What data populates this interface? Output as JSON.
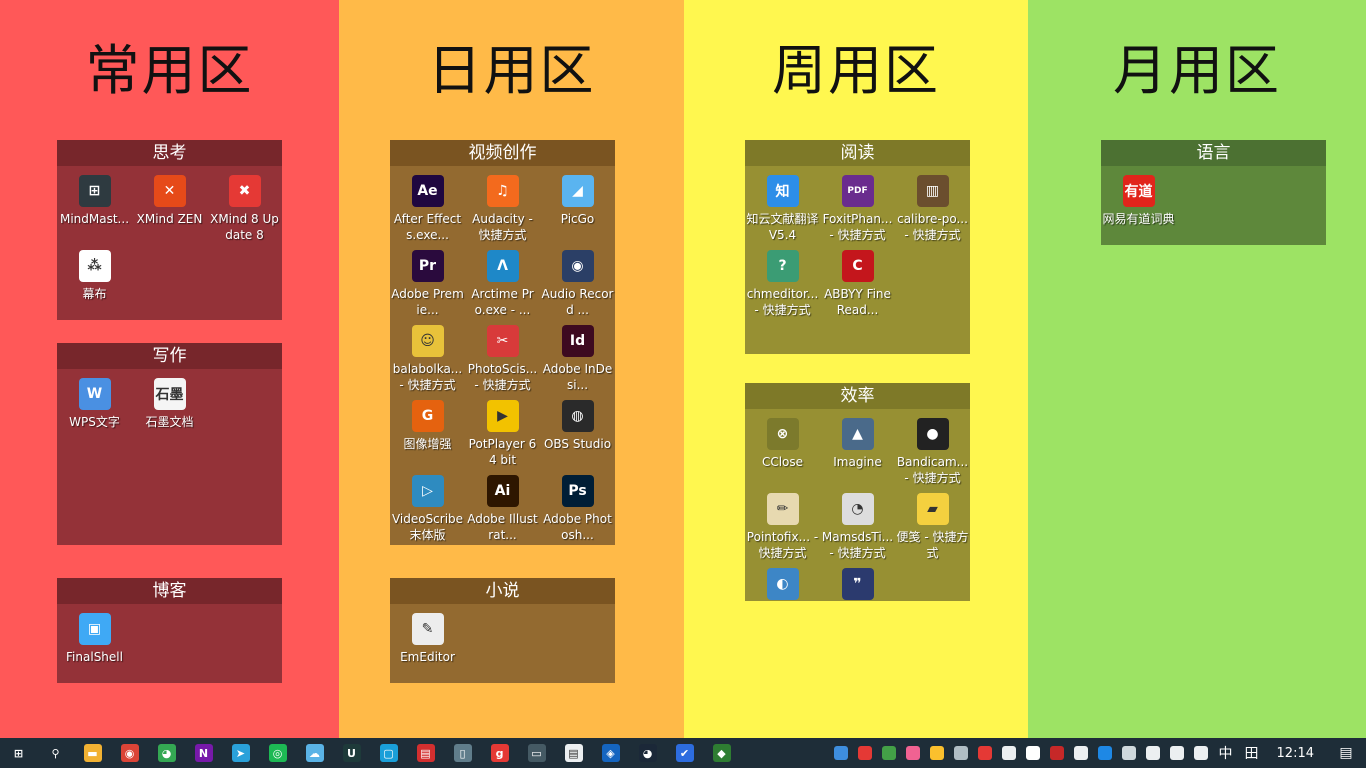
{
  "zones": [
    {
      "title": "常用区"
    },
    {
      "title": "日用区"
    },
    {
      "title": "周用区"
    },
    {
      "title": "月用区"
    }
  ],
  "fences": {
    "sikao": {
      "title": "思考",
      "icons": [
        {
          "label": "MindMast...",
          "icon": "mindmaster-icon",
          "glyph": "⊞",
          "color": "#2E3A40"
        },
        {
          "label": "XMind ZEN",
          "icon": "xmind-zen-icon",
          "glyph": "✕",
          "color": "#E64A19"
        },
        {
          "label": "XMind 8 Update 8",
          "icon": "xmind-8-icon",
          "glyph": "✖",
          "color": "#E53935"
        },
        {
          "label": "幕布",
          "icon": "mubu-icon",
          "glyph": "⁂",
          "color": "#FFFFFF"
        }
      ]
    },
    "xiezuo": {
      "title": "写作",
      "icons": [
        {
          "label": "WPS文字",
          "icon": "wps-writer-icon",
          "glyph": "W",
          "color": "#4A90E2"
        },
        {
          "label": "石墨文档",
          "icon": "shimo-docs-icon",
          "glyph": "石墨",
          "color": "#F5F5F5"
        }
      ]
    },
    "boke": {
      "title": "博客",
      "icons": [
        {
          "label": "FinalShell",
          "icon": "finalshell-icon",
          "glyph": "▣",
          "color": "#3FA9F5"
        }
      ]
    },
    "shipin": {
      "title": "视频创作",
      "icons": [
        {
          "label": "After Effects.exe...",
          "icon": "after-effects-icon",
          "glyph": "Ae",
          "color": "#1F0740"
        },
        {
          "label": "Audacity - 快捷方式",
          "icon": "audacity-icon",
          "glyph": "♫",
          "color": "#F36A1D"
        },
        {
          "label": "PicGo",
          "icon": "picgo-icon",
          "glyph": "◢",
          "color": "#5AB4F0"
        },
        {
          "label": "Adobe Premie...",
          "icon": "premiere-icon",
          "glyph": "Pr",
          "color": "#2A0A3D"
        },
        {
          "label": "Arctime Pro.exe - ...",
          "icon": "arctime-icon",
          "glyph": "Λ",
          "color": "#1E88C8"
        },
        {
          "label": "Audio Record ...",
          "icon": "audio-record-icon",
          "glyph": "◉",
          "color": "#2B3F66"
        },
        {
          "label": "balabolka... - 快捷方式",
          "icon": "balabolka-icon",
          "glyph": "☺",
          "color": "#E8C23A"
        },
        {
          "label": "PhotoScis... - 快捷方式",
          "icon": "photoscissors-icon",
          "glyph": "✂",
          "color": "#D83A3A"
        },
        {
          "label": "Adobe InDesi...",
          "icon": "indesign-icon",
          "glyph": "Id",
          "color": "#3D0A20"
        },
        {
          "label": "图像增强",
          "icon": "image-enhance-icon",
          "glyph": "G",
          "color": "#E5620F"
        },
        {
          "label": "PotPlayer 64 bit",
          "icon": "potplayer-icon",
          "glyph": "▶",
          "color": "#F2C200"
        },
        {
          "label": "OBS Studio",
          "icon": "obs-icon",
          "glyph": "◍",
          "color": "#2A2A2A"
        },
        {
          "label": "VideoScribe 末体版",
          "icon": "videoscribe-icon",
          "glyph": "▷",
          "color": "#2E8BC0"
        },
        {
          "label": "Adobe Illustrat...",
          "icon": "illustrator-icon",
          "glyph": "Ai",
          "color": "#2E1600"
        },
        {
          "label": "Adobe Photosh...",
          "icon": "photoshop-icon",
          "glyph": "Ps",
          "color": "#001E36"
        }
      ]
    },
    "xiaoshuo": {
      "title": "小说",
      "icons": [
        {
          "label": "EmEditor",
          "icon": "emeditor-icon",
          "glyph": "✎",
          "color": "#EDEDED"
        }
      ]
    },
    "yuedu": {
      "title": "阅读",
      "icons": [
        {
          "label": "知云文献翻译V5.4",
          "icon": "zhiyun-icon",
          "glyph": "知",
          "color": "#2C8EE8"
        },
        {
          "label": "FoxitPhan... - 快捷方式",
          "icon": "foxit-phantom-icon",
          "glyph": "PDF",
          "color": "#6A2C8E"
        },
        {
          "label": "calibre-po... - 快捷方式",
          "icon": "calibre-icon",
          "glyph": "▥",
          "color": "#6B4E2E"
        },
        {
          "label": "chmeditor... - 快捷方式",
          "icon": "chmeditor-icon",
          "glyph": "?",
          "color": "#3B9C74"
        },
        {
          "label": "ABBYY FineRead...",
          "icon": "abbyy-icon",
          "glyph": "C",
          "color": "#C4161C"
        }
      ]
    },
    "xiaolv": {
      "title": "效率",
      "icons": [
        {
          "label": "CClose",
          "icon": "cclose-icon",
          "glyph": "⊗",
          "color": "#7C7A2C"
        },
        {
          "label": "Imagine",
          "icon": "imagine-icon",
          "glyph": "▲",
          "color": "#4A6A8A"
        },
        {
          "label": "Bandicam... - 快捷方式",
          "icon": "bandicam-icon",
          "glyph": "●",
          "color": "#222222"
        },
        {
          "label": "Pointofix... - 快捷方式",
          "icon": "pointofix-icon",
          "glyph": "✏",
          "color": "#E7D9B0"
        },
        {
          "label": "MamsdsTi... - 快捷方式",
          "icon": "mamsds-timer-icon",
          "glyph": "◔",
          "color": "#DDDDDD"
        },
        {
          "label": "便笺 - 快捷方式",
          "icon": "sticky-notes-icon",
          "glyph": "▰",
          "color": "#F4D03F"
        },
        {
          "label": "",
          "icon": "globe-app-icon",
          "glyph": "◐",
          "color": "#3D86C6"
        },
        {
          "label": "",
          "icon": "quote-app-icon",
          "glyph": "❞",
          "color": "#2B3A6E"
        }
      ]
    },
    "yuyan": {
      "title": "语言",
      "icons": [
        {
          "label": "网易有道词典",
          "icon": "youdao-dict-icon",
          "glyph": "有道",
          "color": "#E1251B"
        }
      ]
    }
  },
  "taskbar": {
    "pinned": [
      {
        "icon": "windows-start-icon",
        "glyph": "⊞",
        "color": "#1E2D38"
      },
      {
        "icon": "search-icon",
        "glyph": "⚲",
        "color": "#1E2D38"
      },
      {
        "icon": "file-explorer-icon",
        "glyph": "▬",
        "color": "#F2B233"
      },
      {
        "icon": "chrome-icon",
        "glyph": "◉",
        "color": "#DB4437"
      },
      {
        "icon": "color-app-icon",
        "glyph": "◕",
        "color": "#34A853"
      },
      {
        "icon": "onenote-icon",
        "glyph": "N",
        "color": "#7719AA"
      },
      {
        "icon": "telegram-icon",
        "glyph": "➤",
        "color": "#2AA1DA"
      },
      {
        "icon": "green-app-icon",
        "glyph": "◎",
        "color": "#1DB954"
      },
      {
        "icon": "cloud-icon",
        "glyph": "☁",
        "color": "#5AB3E6"
      },
      {
        "icon": "upwork-icon",
        "glyph": "U",
        "color": "#1E3A3A"
      },
      {
        "icon": "window-app-icon",
        "glyph": "▢",
        "color": "#1A9FD9"
      },
      {
        "icon": "photo-app-icon",
        "glyph": "▤",
        "color": "#D32F2F"
      },
      {
        "icon": "phone-app-icon",
        "glyph": "▯",
        "color": "#607D8B"
      },
      {
        "icon": "red-app-icon",
        "glyph": "g",
        "color": "#E53935"
      },
      {
        "icon": "monitor-app-icon",
        "glyph": "▭",
        "color": "#455A64"
      },
      {
        "icon": "notes-app-icon",
        "glyph": "▤",
        "color": "#ECEFF1"
      },
      {
        "icon": "shield-app-icon",
        "glyph": "◈",
        "color": "#1565C0"
      },
      {
        "icon": "steam-icon",
        "glyph": "◕",
        "color": "#1B2838"
      },
      {
        "icon": "todo-icon",
        "glyph": "✔",
        "color": "#2D6CDF"
      },
      {
        "icon": "active-app-icon",
        "glyph": "◆",
        "color": "#2E7D32"
      }
    ],
    "tray": [
      {
        "icon": "tray-blue-icon",
        "color": "#3E8EDE"
      },
      {
        "icon": "tray-red-icon",
        "color": "#E53935"
      },
      {
        "icon": "tray-green-icon",
        "color": "#43A047"
      },
      {
        "icon": "tray-pig-icon",
        "color": "#F06292"
      },
      {
        "icon": "tray-chrome-icon",
        "color": "#FBC02D"
      },
      {
        "icon": "tray-cloud-icon",
        "color": "#B0BEC5"
      },
      {
        "icon": "tray-screen-icon",
        "color": "#E53935"
      },
      {
        "icon": "tray-gear-icon",
        "color": "#ECEFF1"
      },
      {
        "icon": "tray-obs-icon",
        "color": "#FFFFFF"
      },
      {
        "icon": "tray-dots-icon",
        "color": "#C62828"
      },
      {
        "icon": "tray-shield-icon",
        "color": "#ECEFF1"
      },
      {
        "icon": "tray-defender-icon",
        "color": "#1E88E5"
      },
      {
        "icon": "tray-close-icon",
        "color": "#CFD8DC"
      },
      {
        "icon": "tray-battery-icon",
        "color": "#ECEFF1"
      },
      {
        "icon": "tray-volume-icon",
        "color": "#ECEFF1"
      },
      {
        "icon": "tray-wifi-icon",
        "color": "#ECEFF1"
      }
    ],
    "ime_label": "中",
    "ime_mode_glyph": "田",
    "clock": "12:14",
    "notification_glyph": "▤"
  }
}
